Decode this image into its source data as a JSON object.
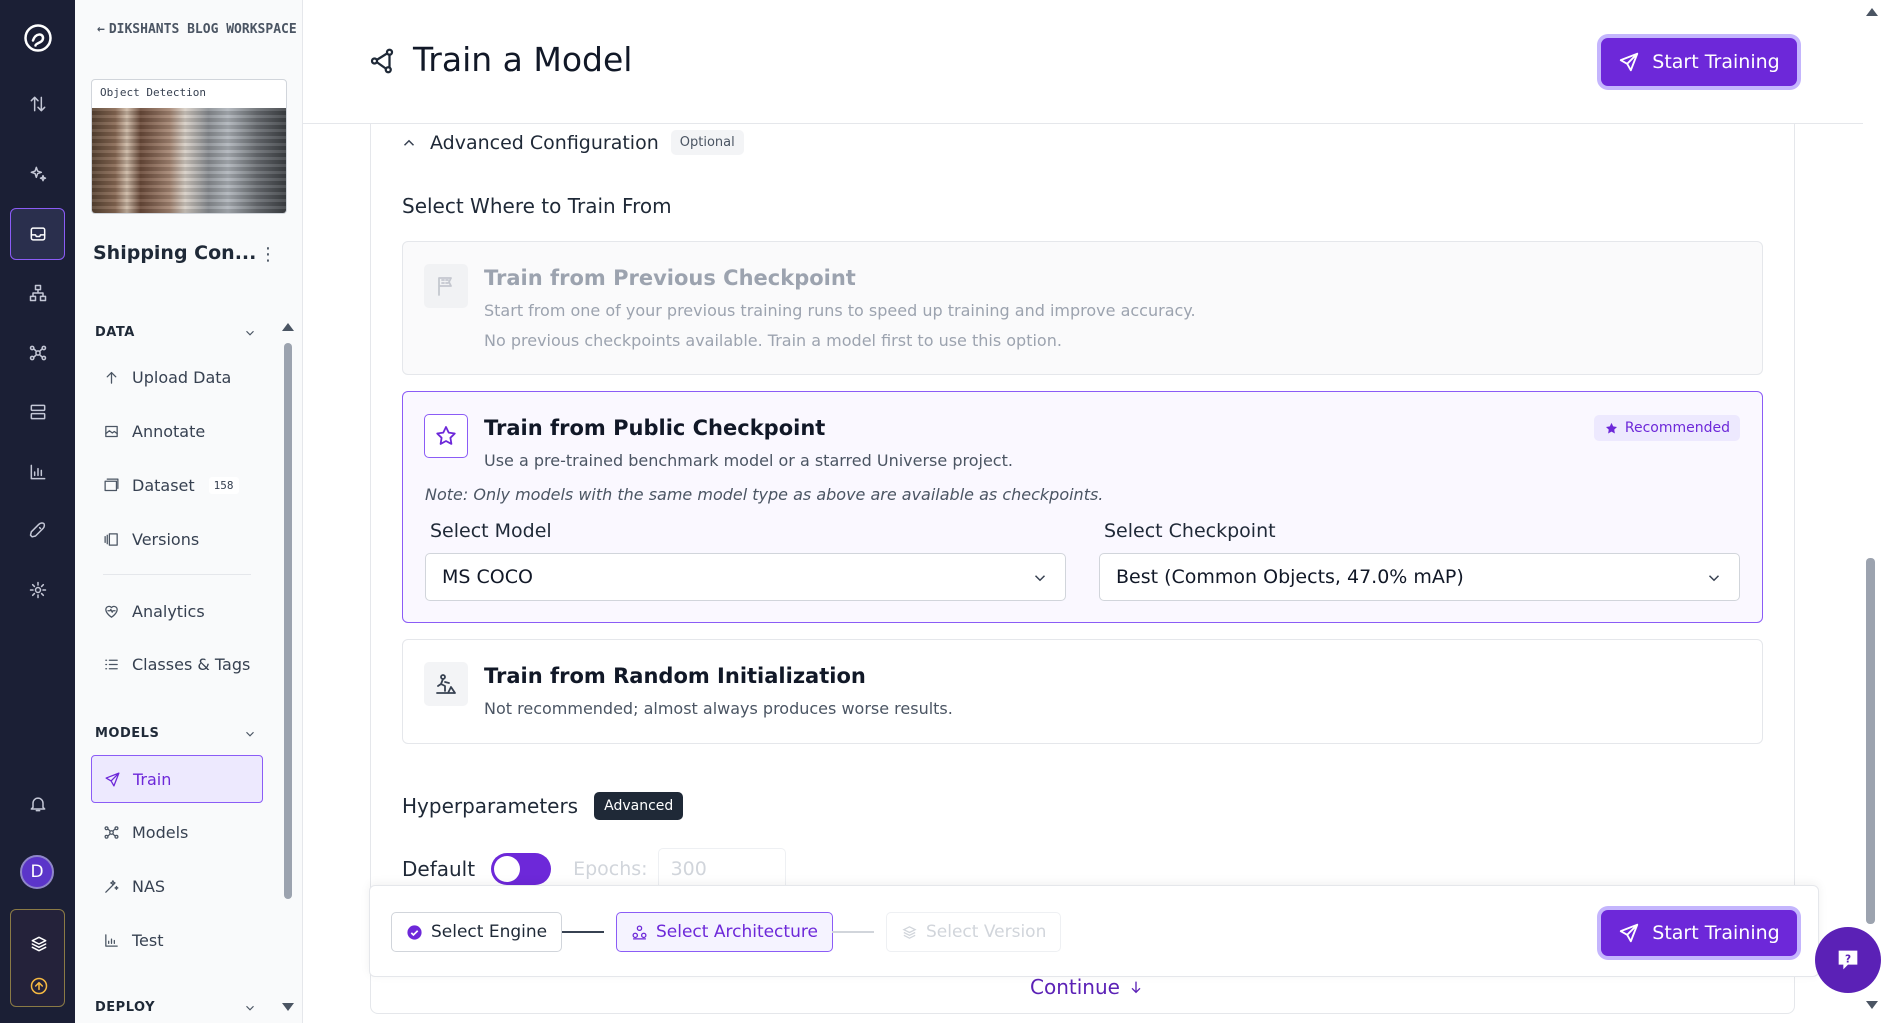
{
  "workspace": {
    "back_label": "DIKSHANTS BLOG WORKSPACE"
  },
  "project": {
    "type_label": "Object Detection",
    "name": "Shipping Con...",
    "menu_glyph": "⋮"
  },
  "sidebar": {
    "data_section": "DATA",
    "models_section": "MODELS",
    "deploy_section": "DEPLOY",
    "data_items": [
      {
        "label": "Upload Data",
        "icon": "upload-icon"
      },
      {
        "label": "Annotate",
        "icon": "annotate-icon"
      },
      {
        "label": "Dataset",
        "icon": "dataset-icon",
        "badge": "158"
      },
      {
        "label": "Versions",
        "icon": "versions-icon"
      },
      {
        "label": "Analytics",
        "icon": "analytics-icon"
      },
      {
        "label": "Classes & Tags",
        "icon": "classes-icon"
      }
    ],
    "model_items": [
      {
        "label": "Train",
        "icon": "train-icon",
        "active": true
      },
      {
        "label": "Models",
        "icon": "models-icon"
      },
      {
        "label": "NAS",
        "icon": "nas-icon"
      },
      {
        "label": "Test",
        "icon": "test-icon"
      }
    ]
  },
  "rail": {
    "avatar_initial": "D"
  },
  "header": {
    "title": "Train a Model",
    "start_training_label": "Start Training"
  },
  "advanced": {
    "label": "Advanced Configuration",
    "optional_pill": "Optional",
    "where_title": "Select Where to Train From"
  },
  "options": {
    "previous": {
      "title": "Train from Previous Checkpoint",
      "desc": "Start from one of your previous training runs to speed up training and improve accuracy.",
      "desc2": "No previous checkpoints available. Train a model first to use this option."
    },
    "public": {
      "title": "Train from Public Checkpoint",
      "desc": "Use a pre-trained benchmark model or a starred Universe project.",
      "recommended": "Recommended",
      "note": "Note:  Only models with the same model type as above are available as checkpoints.",
      "select_model_label": "Select Model",
      "select_model_value": "MS COCO",
      "select_checkpoint_label": "Select Checkpoint",
      "select_checkpoint_value": "Best (Common Objects, 47.0% mAP)"
    },
    "random": {
      "title": "Train from Random Initialization",
      "desc": "Not recommended; almost always produces worse results."
    }
  },
  "hyperparameters": {
    "title": "Hyperparameters",
    "advanced_pill": "Advanced",
    "default_label": "Default",
    "epochs_label": "Epochs:",
    "epochs_value": "300"
  },
  "footer": {
    "step1": "Select Engine",
    "step2": "Select Architecture",
    "step3": "Select Version",
    "start_training_label": "Start Training",
    "continue_label": "Continue"
  },
  "colors": {
    "accent": "#6d28d9",
    "rail_bg": "#1b1f35"
  }
}
